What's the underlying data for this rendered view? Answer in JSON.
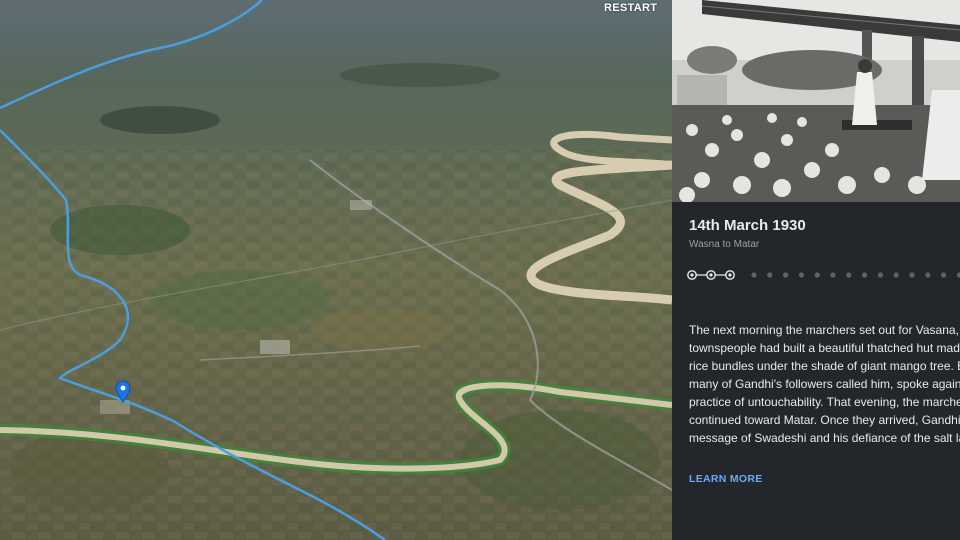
{
  "controls": {
    "restart_label": "RESTART"
  },
  "story": {
    "date": "14th March 1930",
    "route": "Wasna to Matar",
    "progress": {
      "total_steps": 17,
      "current_step": 3
    },
    "body_lines": [
      "The next morning the marchers set out for Vasana,",
      "townspeople had built a beautiful thatched hut mad",
      "rice bundles under the shade of giant mango tree. B",
      "many of Gandhi's followers called him, spoke agains",
      "practice of untouchability. That evening, the marche",
      "continued toward Matar. Once they arrived, Gandhi s",
      "message of Swadeshi and his defiance of the salt la"
    ],
    "learn_more_label": "LEARN MORE"
  },
  "map": {
    "route_color": "#4a9fe0",
    "pin_color": "#1a73e8",
    "pin_icon": "map-pin-icon"
  },
  "theme": {
    "panel_bg": "#23272b",
    "link_color": "#6fa8f5"
  }
}
